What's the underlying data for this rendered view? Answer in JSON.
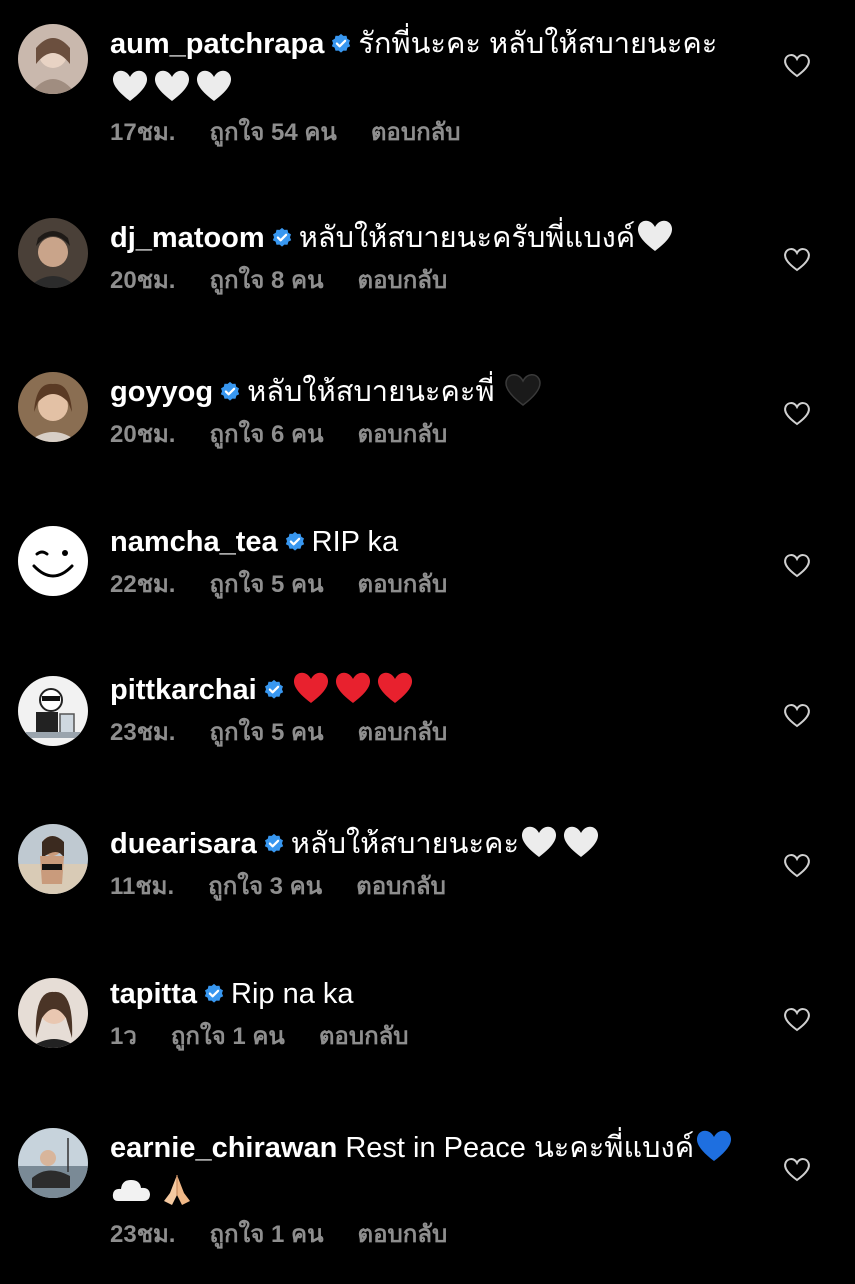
{
  "colors": {
    "background": "#000000",
    "text": "#ffffff",
    "meta": "#8e8e8e",
    "verified": "#3897f0"
  },
  "icons": {
    "verified": "verified-badge-icon",
    "like": "heart-outline-icon"
  },
  "comments": [
    {
      "username": "aum_patchrapa",
      "verified": true,
      "text": "รักพี่นะคะ หลับให้สบายนะคะ",
      "emojis": [
        "white-heart",
        "white-heart",
        "white-heart"
      ],
      "time": "17ชม.",
      "likes": "ถูกใจ 54 คน",
      "reply": "ตอบกลับ"
    },
    {
      "username": "dj_matoom",
      "verified": true,
      "text": "หลับให้สบายนะครับพี่แบงค์",
      "emojis": [
        "white-heart"
      ],
      "time": "20ชม.",
      "likes": "ถูกใจ 8 คน",
      "reply": "ตอบกลับ"
    },
    {
      "username": "goyyog",
      "verified": true,
      "text": "หลับให้สบายนะคะพี่ ",
      "emojis": [
        "black-heart"
      ],
      "time": "20ชม.",
      "likes": "ถูกใจ 6 คน",
      "reply": "ตอบกลับ"
    },
    {
      "username": "namcha_tea",
      "verified": true,
      "text": "RIP ka",
      "emojis": [],
      "time": "22ชม.",
      "likes": "ถูกใจ 5 คน",
      "reply": "ตอบกลับ"
    },
    {
      "username": "pittkarchai",
      "verified": true,
      "text": "",
      "emojis": [
        "red-heart",
        "red-heart",
        "red-heart"
      ],
      "time": "23ชม.",
      "likes": "ถูกใจ 5 คน",
      "reply": "ตอบกลับ"
    },
    {
      "username": "duearisara",
      "verified": true,
      "text": "หลับให้สบายนะคะ",
      "emojis": [
        "white-heart",
        "white-heart"
      ],
      "time": "11ชม.",
      "likes": "ถูกใจ 3 คน",
      "reply": "ตอบกลับ"
    },
    {
      "username": "tapitta",
      "verified": true,
      "text": "Rip na ka",
      "emojis": [],
      "time": "1ว",
      "likes": "ถูกใจ 1 คน",
      "reply": "ตอบกลับ"
    },
    {
      "username": "earnie_chirawan",
      "verified": false,
      "text": "Rest in Peace นะคะพี่แบงค์",
      "emojis": [
        "blue-heart",
        "cloud",
        "folded-hands"
      ],
      "time": "23ชม.",
      "likes": "ถูกใจ 1 คน",
      "reply": "ตอบกลับ"
    }
  ]
}
